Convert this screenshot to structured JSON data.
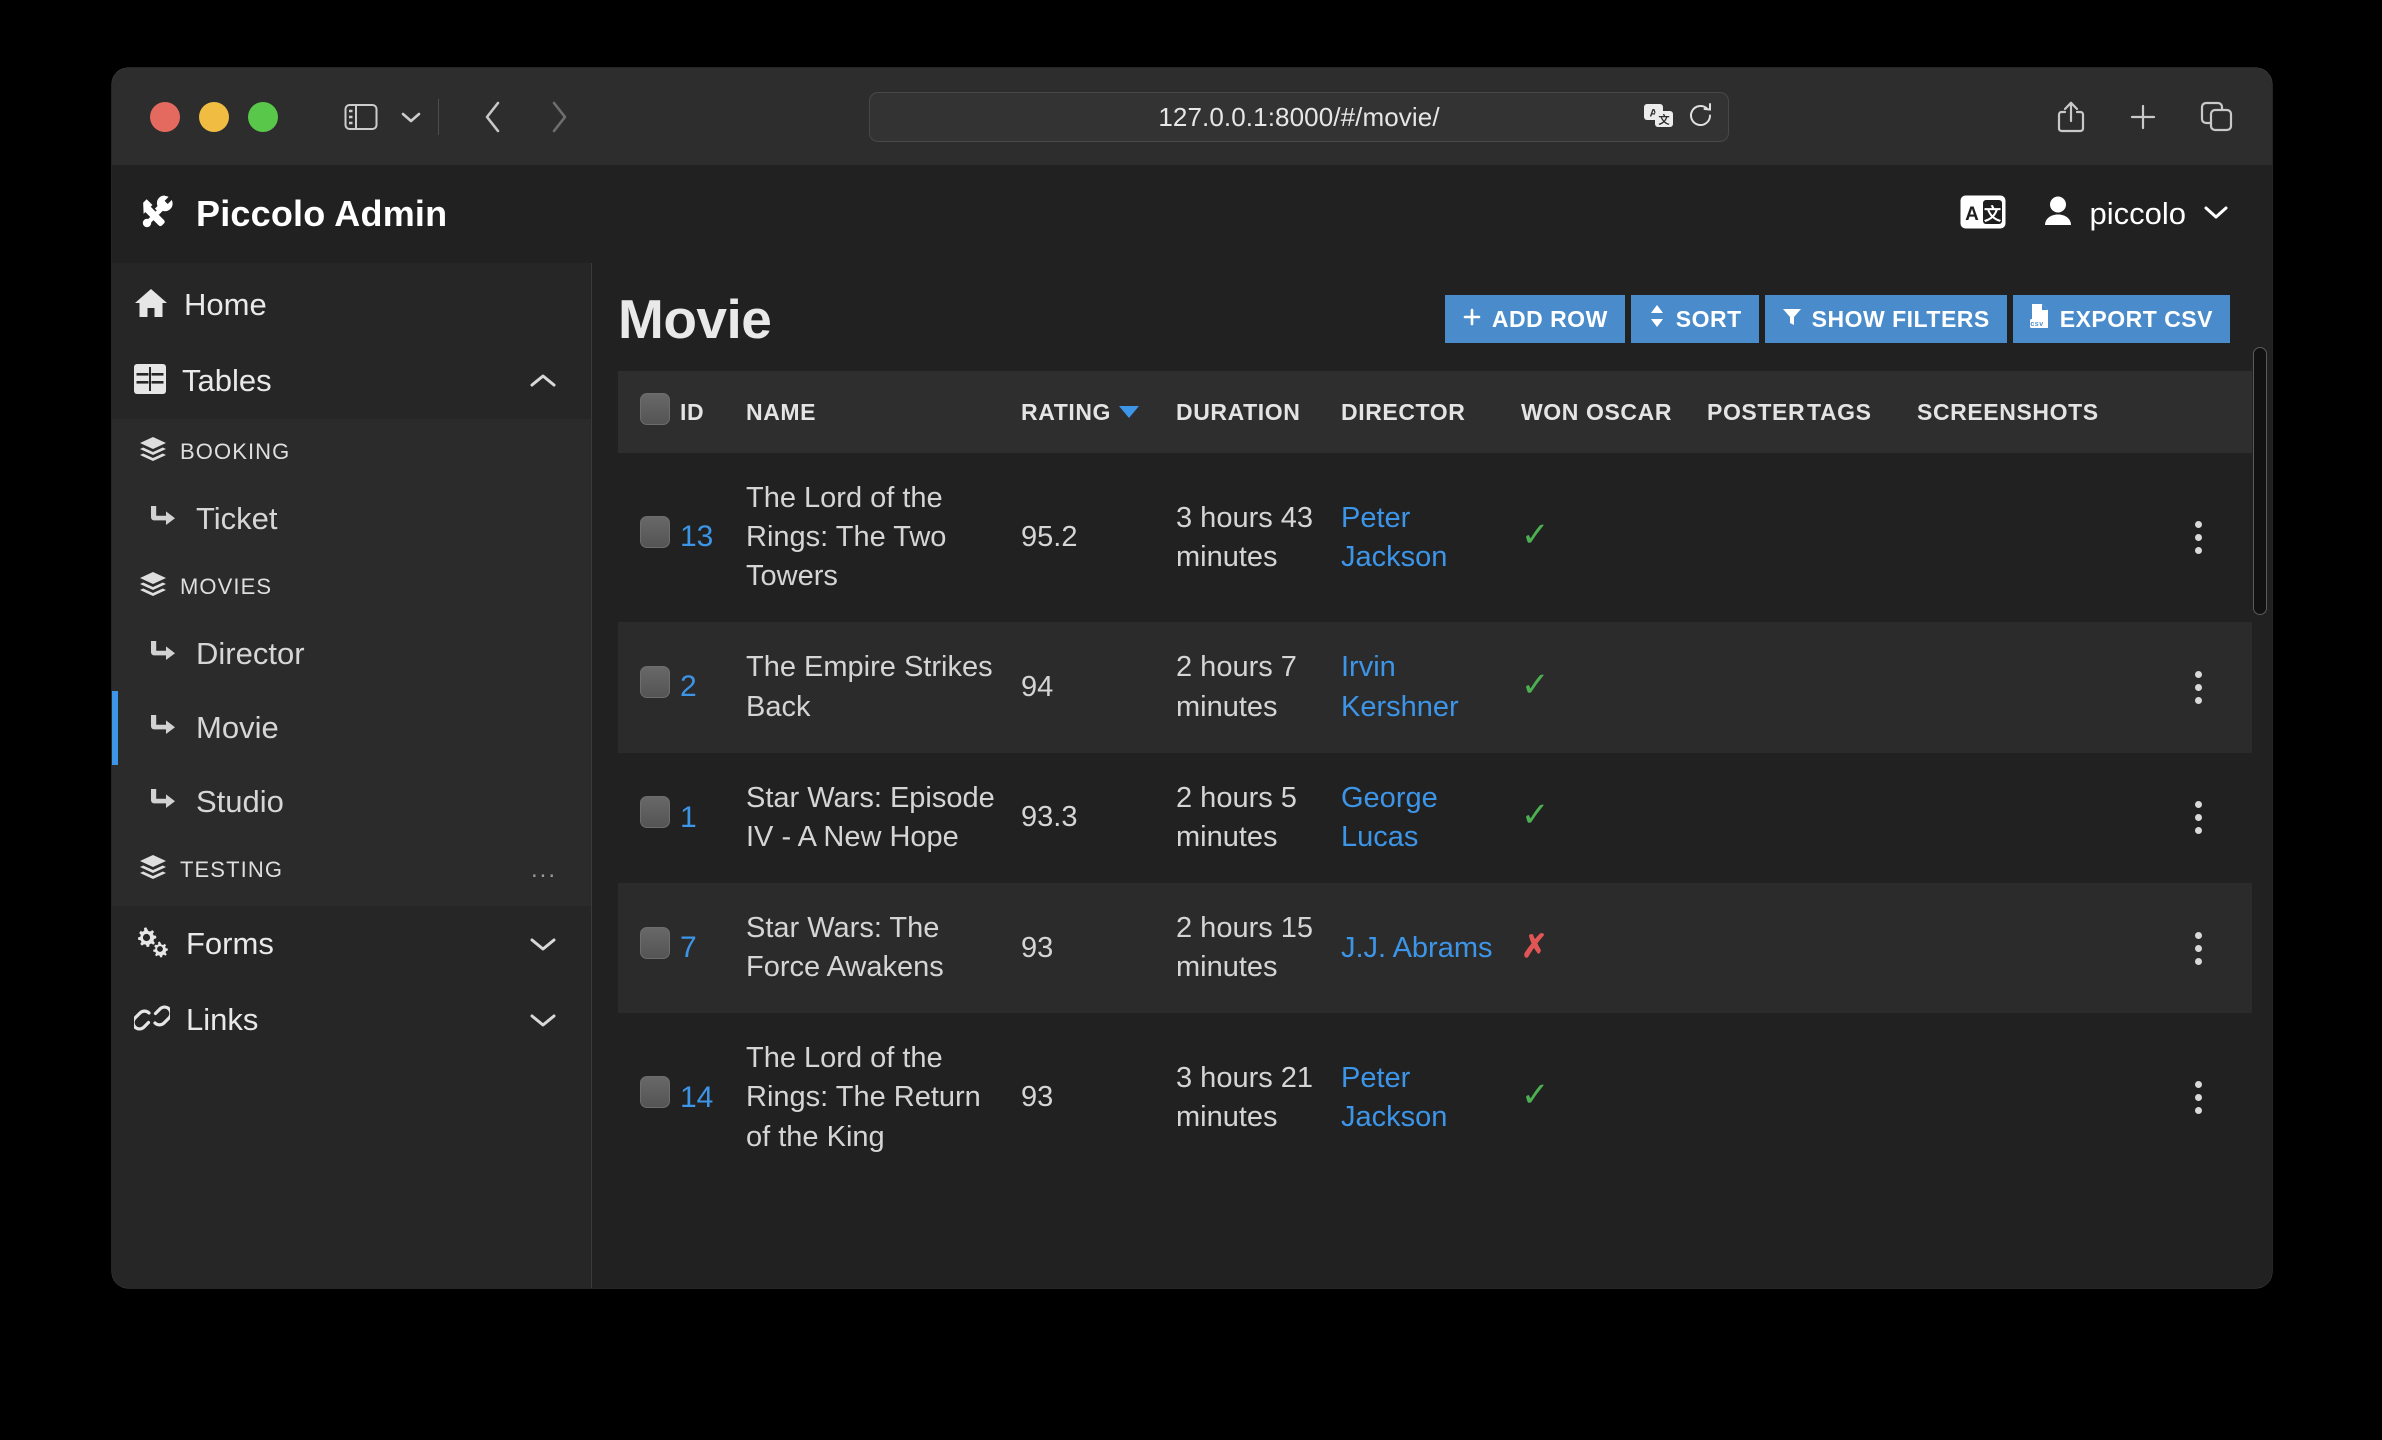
{
  "browser": {
    "url": "127.0.0.1:8000/#/movie/",
    "icons": {
      "sidebar_toggle": "sidebar-toggle-icon",
      "tab_chevron": "chevron-down-icon",
      "back": "back-arrow-icon",
      "forward": "forward-arrow-icon",
      "translate": "translate-icon",
      "reload": "reload-icon",
      "share": "share-icon",
      "new_tab": "plus-icon",
      "tab_overview": "tab-overview-icon"
    },
    "traffic_lights": [
      "close",
      "minimize",
      "zoom"
    ]
  },
  "app_header": {
    "brand": "Piccolo Admin",
    "brand_icon": "tools-icon",
    "language_icon": "language-translate-icon",
    "user_icon": "user-avatar-icon",
    "username": "piccolo",
    "user_chevron": "chevron-down-icon"
  },
  "sidebar": {
    "home": {
      "label": "Home",
      "icon": "home-icon"
    },
    "tables": {
      "label": "Tables",
      "icon": "table-grid-icon",
      "chevron": "chevron-up-icon",
      "expanded": true
    },
    "groups": [
      {
        "label": "BOOKING",
        "icon": "layers-icon",
        "more": "",
        "items": [
          {
            "label": "Ticket",
            "icon": "arrow-right-turn-icon",
            "active": false
          }
        ]
      },
      {
        "label": "MOVIES",
        "icon": "layers-icon",
        "more": "",
        "items": [
          {
            "label": "Director",
            "icon": "arrow-right-turn-icon",
            "active": false
          },
          {
            "label": "Movie",
            "icon": "arrow-right-turn-icon",
            "active": true
          },
          {
            "label": "Studio",
            "icon": "arrow-right-turn-icon",
            "active": false
          }
        ]
      },
      {
        "label": "TESTING",
        "icon": "layers-icon",
        "more": "...",
        "items": []
      }
    ],
    "forms": {
      "label": "Forms",
      "icon": "gears-icon",
      "chevron": "chevron-down-icon"
    },
    "links": {
      "label": "Links",
      "icon": "chain-link-icon",
      "chevron": "chevron-down-icon"
    }
  },
  "main": {
    "title": "Movie",
    "buttons": [
      {
        "label": "ADD ROW",
        "icon": "plus-icon"
      },
      {
        "label": "SORT",
        "icon": "sort-updown-icon"
      },
      {
        "label": "SHOW FILTERS",
        "icon": "funnel-icon"
      },
      {
        "label": "EXPORT CSV",
        "icon": "csv-file-icon"
      }
    ],
    "accent_color": "#4a8ccb",
    "link_color": "#3d95e8",
    "tick_color": "#4caf50",
    "cross_color": "#e05555",
    "table": {
      "sort_column": "RATING",
      "sort_direction": "desc",
      "columns": [
        "ID",
        "NAME",
        "RATING",
        "DURATION",
        "DIRECTOR",
        "WON OSCAR",
        "POSTER",
        "TAGS",
        "SCREENSHOTS"
      ],
      "rows": [
        {
          "id": "13",
          "name": "The Lord of the Rings: The Two Towers",
          "rating": "95.2",
          "duration": "3 hours 43 minutes",
          "director": "Peter Jackson",
          "won_oscar": "yes",
          "poster": "",
          "tags": "",
          "screenshots": ""
        },
        {
          "id": "2",
          "name": "The Empire Strikes Back",
          "rating": "94",
          "duration": "2 hours 7 minutes",
          "director": "Irvin Kershner",
          "won_oscar": "yes",
          "poster": "",
          "tags": "",
          "screenshots": ""
        },
        {
          "id": "1",
          "name": "Star Wars: Episode IV - A New Hope",
          "rating": "93.3",
          "duration": "2 hours 5 minutes",
          "director": "George Lucas",
          "won_oscar": "yes",
          "poster": "",
          "tags": "",
          "screenshots": ""
        },
        {
          "id": "7",
          "name": "Star Wars: The Force Awakens",
          "rating": "93",
          "duration": "2 hours 15 minutes",
          "director": "J.J. Abrams",
          "won_oscar": "no",
          "poster": "",
          "tags": "",
          "screenshots": ""
        },
        {
          "id": "14",
          "name": "The Lord of the Rings: The Return of the King",
          "rating": "93",
          "duration": "3 hours 21 minutes",
          "director": "Peter Jackson",
          "won_oscar": "yes",
          "poster": "",
          "tags": "",
          "screenshots": ""
        }
      ]
    }
  }
}
